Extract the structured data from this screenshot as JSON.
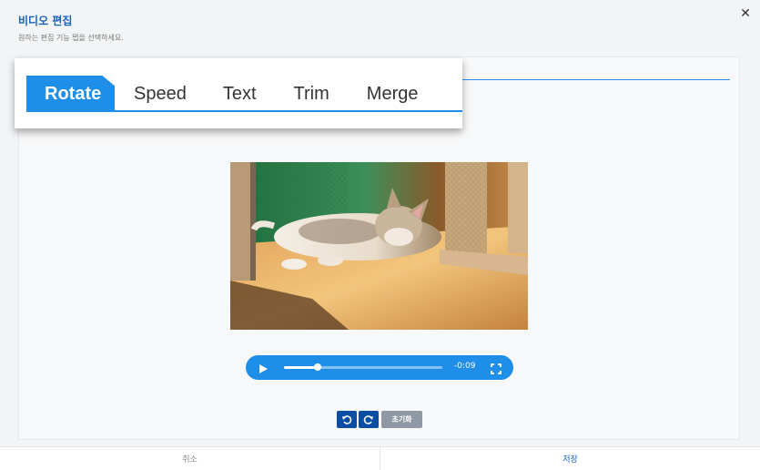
{
  "dialog": {
    "title": "비디오 편집",
    "subtitle": "원하는 편집 기능 탭을 선택하세요.",
    "close_label": "✕"
  },
  "tabs": [
    {
      "label": "Rotate",
      "active": true
    },
    {
      "label": "Speed",
      "active": false
    },
    {
      "label": "Text",
      "active": false
    },
    {
      "label": "Trim",
      "active": false
    },
    {
      "label": "Merge",
      "active": false
    }
  ],
  "player": {
    "time": "-0:09",
    "progress": 0.21,
    "play_icon": "play-icon",
    "fullscreen_icon": "fullscreen-icon"
  },
  "controls": {
    "rotate_left_icon": "rotate-left-icon",
    "rotate_right_icon": "rotate-right-icon",
    "reset_label": "초기화"
  },
  "footer": {
    "cancel_label": "취소",
    "save_label": "저장"
  },
  "colors": {
    "accent": "#1f8ee8",
    "title": "#1763b8",
    "rotate_button": "#0a4da3",
    "reset_button": "#8f98a3"
  }
}
